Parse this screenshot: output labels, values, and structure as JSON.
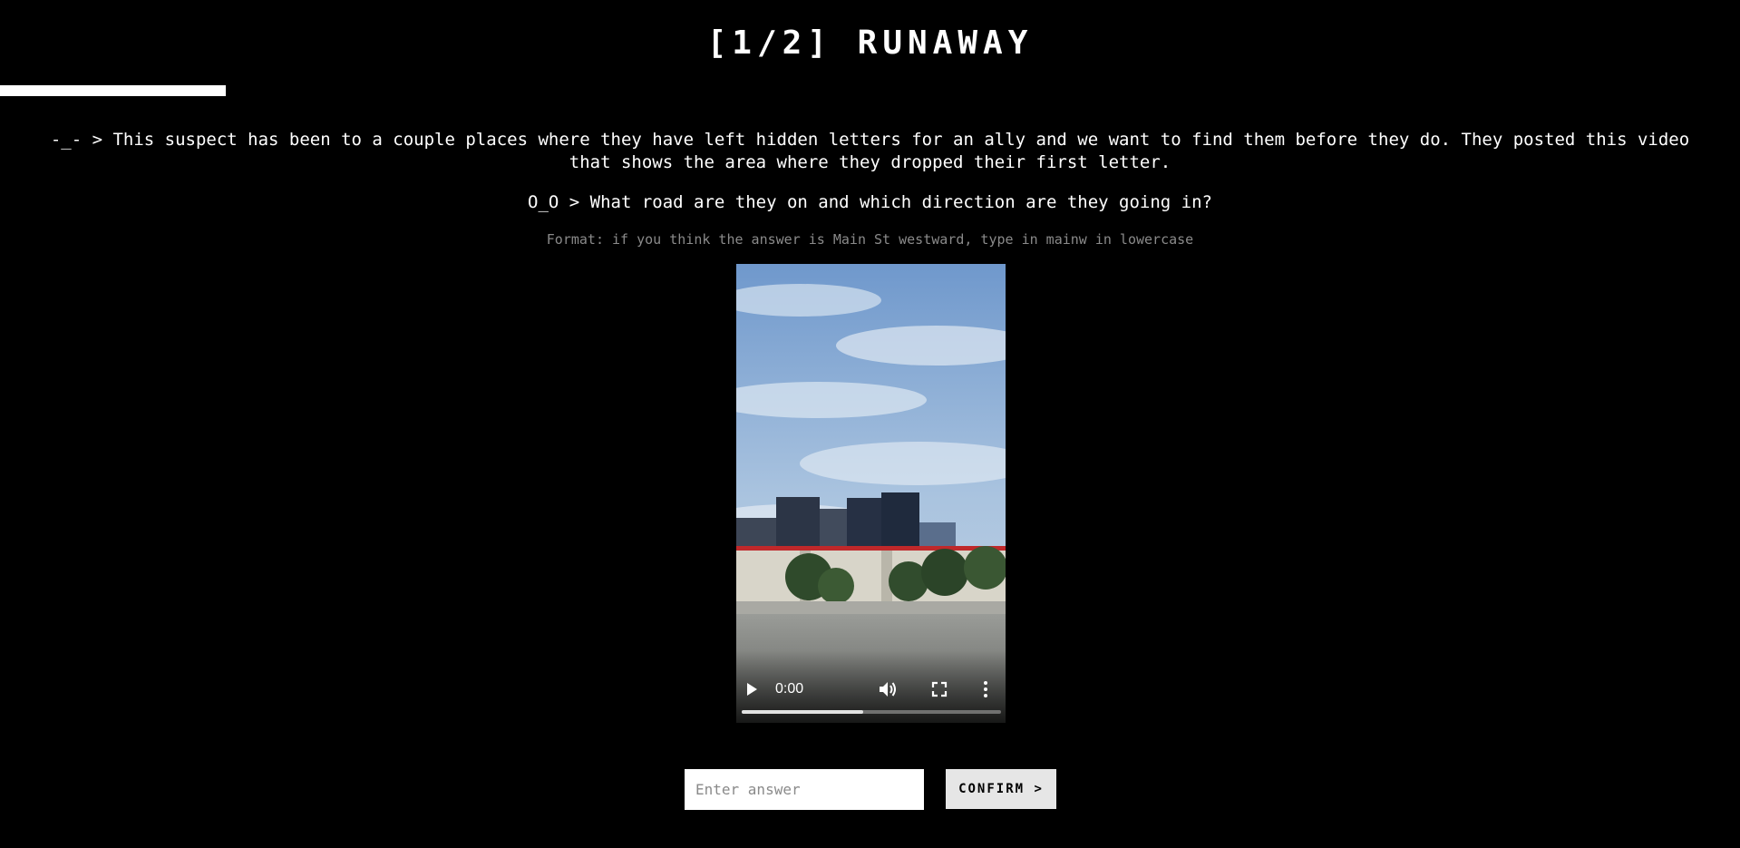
{
  "header": {
    "title": "[1/2] RUNAWAY",
    "progress_fraction": 0.13
  },
  "story": {
    "intro": "-_- > This suspect has been to a couple places where they have left hidden letters for an ally and we want to find them before they do. They posted this video that shows the area where they dropped their first letter.",
    "question": "O_O > What road are they on and which direction are they going in?",
    "format_hint": "Format: if you think the answer is Main St westward, type in mainw in lowercase"
  },
  "video": {
    "current_time": "0:00",
    "buffered_fraction": 0.47,
    "icons": {
      "play": "play-icon",
      "volume": "volume-icon",
      "fullscreen": "fullscreen-icon",
      "more": "more-options-icon"
    }
  },
  "answer": {
    "placeholder": "Enter answer",
    "value": "",
    "confirm_label": "CONFIRM >"
  },
  "colors": {
    "background": "#000000",
    "text": "#ffffff",
    "hint": "#8a8a8a",
    "button_bg": "#e6e6e6"
  }
}
